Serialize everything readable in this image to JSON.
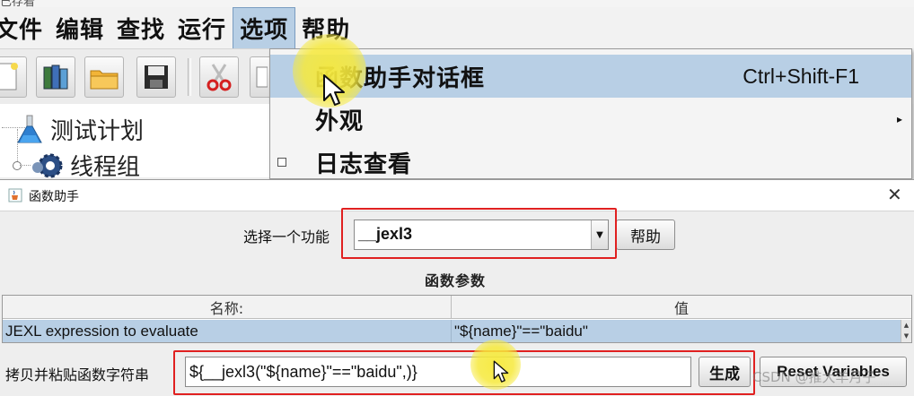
{
  "window": {
    "title_partial": "已存着"
  },
  "menubar": {
    "items": [
      "文件",
      "编辑",
      "查找",
      "运行",
      "选项",
      "帮助"
    ],
    "active": "选项"
  },
  "toolbar": {
    "icons": [
      "new-document-icon",
      "templates-icon",
      "open-folder-icon",
      "save-icon",
      "cut-icon",
      "copy-icon"
    ]
  },
  "tree": {
    "nodes": [
      {
        "label": "测试计划",
        "icon": "test-plan-flask-icon"
      },
      {
        "label": "线程组",
        "icon": "thread-group-gear-icon"
      }
    ]
  },
  "options_menu": {
    "items": [
      {
        "label": "函数助手对话框",
        "shortcut": "Ctrl+Shift-F1",
        "highlighted": true
      },
      {
        "label": "外观",
        "has_submenu": true
      },
      {
        "label": "日志查看",
        "checkbox": true
      }
    ]
  },
  "dialog": {
    "title": "函数助手",
    "select_label": "选择一个功能",
    "selected_function": "__jexl3",
    "help_button": "帮助",
    "params_title": "函数参数",
    "table": {
      "headers": [
        "名称:",
        "值"
      ],
      "rows": [
        {
          "name": "JEXL expression to evaluate",
          "value": "\"${name}\"==\"baidu\""
        }
      ]
    },
    "copy_label": "拷贝并粘贴函数字符串",
    "function_string": "${__jexl3(\"${name}\"==\"baidu\",)}",
    "generate_button": "生成",
    "reset_button": "Reset Variables"
  },
  "watermark": "CSDN @推大羊月子",
  "colors": {
    "menu_highlight": "#b8cfe5",
    "annotation_red": "#e02020",
    "cursor_highlight": "#f6e93c"
  }
}
